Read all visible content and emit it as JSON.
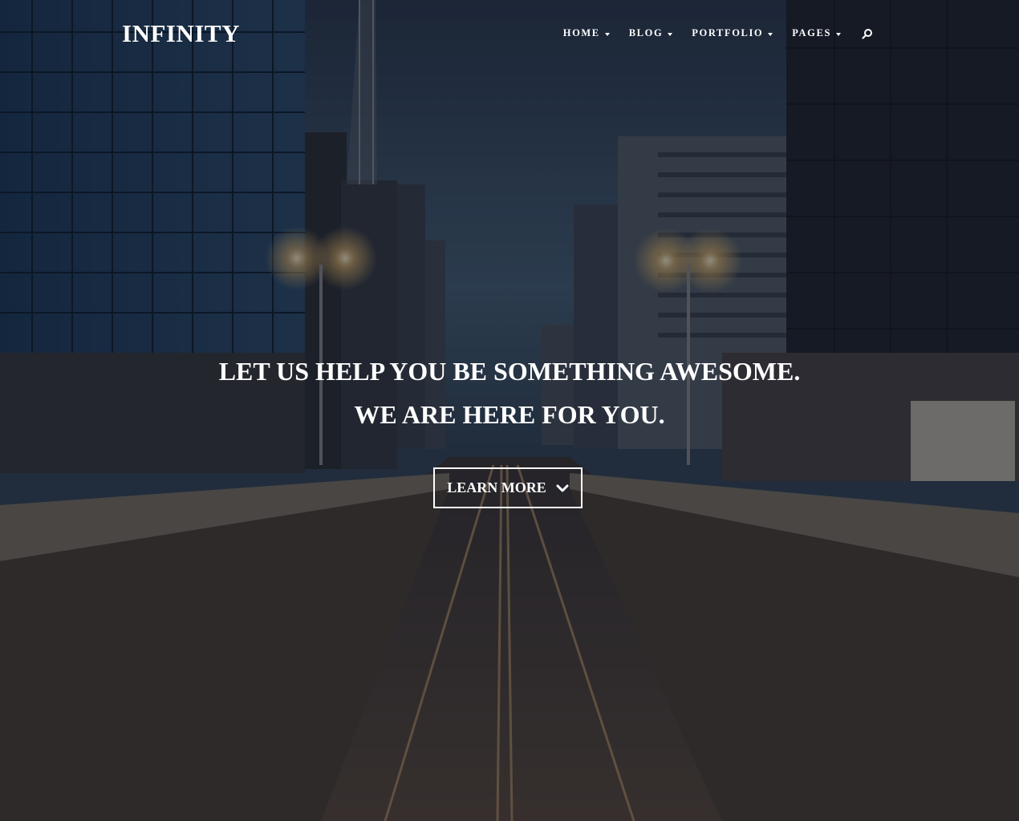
{
  "site": {
    "logo": "INFINITY"
  },
  "nav": {
    "items": [
      {
        "label": "HOME",
        "has_dropdown": true
      },
      {
        "label": "BLOG",
        "has_dropdown": true
      },
      {
        "label": "PORTFOLIO",
        "has_dropdown": true
      },
      {
        "label": "PAGES",
        "has_dropdown": true
      }
    ],
    "search_icon": "search-icon"
  },
  "hero": {
    "headline_line1": "LET US HELP YOU BE SOMETHING AWESOME.",
    "headline_line2": "WE ARE HERE FOR YOU.",
    "cta_label": "LEARN MORE",
    "cta_icon": "chevron-down-icon",
    "background": "city-avenue-photo"
  },
  "colors": {
    "text": "#ffffff",
    "overlay": "#0c1018"
  }
}
